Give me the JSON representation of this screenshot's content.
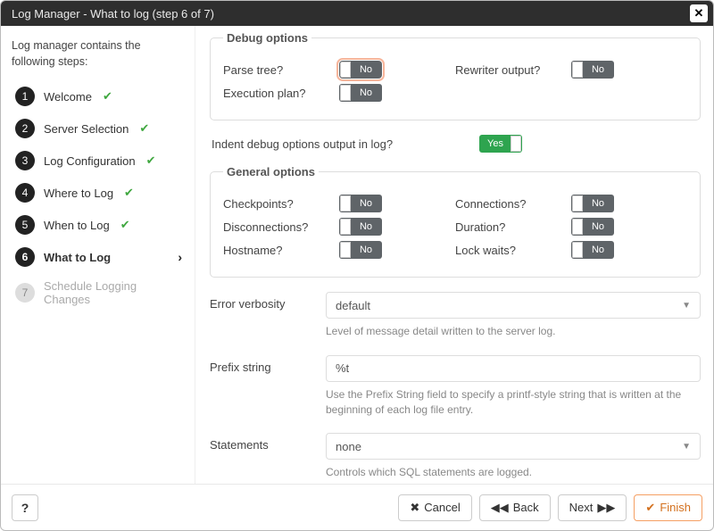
{
  "titlebar": {
    "title": "Log Manager - What to log (step 6 of 7)"
  },
  "sidebar": {
    "intro": "Log manager contains the following steps:",
    "steps": [
      {
        "num": "1",
        "label": "Welcome",
        "done": true
      },
      {
        "num": "2",
        "label": "Server Selection",
        "done": true
      },
      {
        "num": "3",
        "label": "Log Configuration",
        "done": true
      },
      {
        "num": "4",
        "label": "Where to Log",
        "done": true
      },
      {
        "num": "5",
        "label": "When to Log",
        "done": true
      },
      {
        "num": "6",
        "label": "What to Log",
        "current": true
      },
      {
        "num": "7",
        "label": "Schedule Logging Changes",
        "disabled": true
      }
    ]
  },
  "debug": {
    "legend": "Debug options",
    "parse_tree": {
      "label": "Parse tree?",
      "value": "No",
      "highlight": true
    },
    "rewriter": {
      "label": "Rewriter output?",
      "value": "No"
    },
    "exec_plan": {
      "label": "Execution plan?",
      "value": "No"
    }
  },
  "indent": {
    "label": "Indent debug options output in log?",
    "value": "Yes"
  },
  "general": {
    "legend": "General options",
    "checkpoints": {
      "label": "Checkpoints?",
      "value": "No"
    },
    "connections": {
      "label": "Connections?",
      "value": "No"
    },
    "disconnections": {
      "label": "Disconnections?",
      "value": "No"
    },
    "duration": {
      "label": "Duration?",
      "value": "No"
    },
    "hostname": {
      "label": "Hostname?",
      "value": "No"
    },
    "lockwaits": {
      "label": "Lock waits?",
      "value": "No"
    }
  },
  "verbosity": {
    "label": "Error verbosity",
    "value": "default",
    "hint": "Level of message detail written to the server log."
  },
  "prefix": {
    "label": "Prefix string",
    "value": "%t",
    "hint": "Use the Prefix String field to specify a printf-style string that is written at the beginning of each log file entry."
  },
  "statements": {
    "label": "Statements",
    "value": "none",
    "hint": "Controls which SQL statements are logged."
  },
  "footer": {
    "help": "?",
    "cancel": "Cancel",
    "back": "Back",
    "next": "Next",
    "finish": "Finish"
  }
}
